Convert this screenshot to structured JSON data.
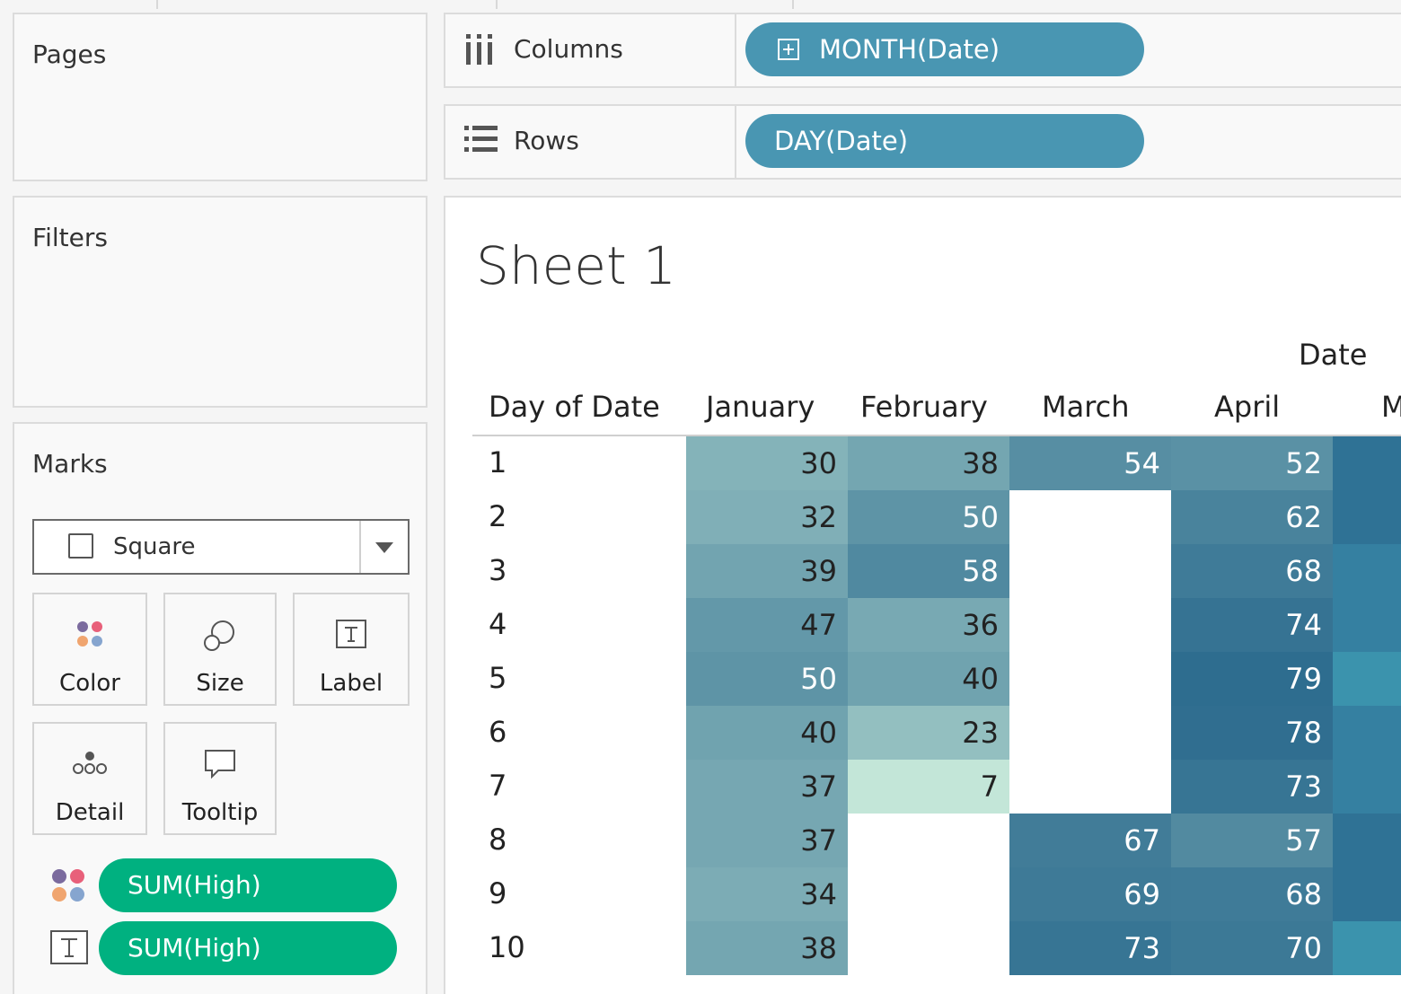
{
  "panels": {
    "pages": {
      "title": "Pages"
    },
    "filters": {
      "title": "Filters"
    },
    "marks": {
      "title": "Marks",
      "mark_type": "Square",
      "buttons": {
        "color": "Color",
        "size": "Size",
        "label": "Label",
        "detail": "Detail",
        "tooltip": "Tooltip"
      },
      "fields": [
        {
          "encoding": "color-icon",
          "label": "SUM(High)"
        },
        {
          "encoding": "label-icon",
          "label": "SUM(High)"
        }
      ]
    }
  },
  "shelves": {
    "columns": {
      "label": "Columns",
      "pill": "MONTH(Date)"
    },
    "rows": {
      "label": "Rows",
      "pill": "DAY(Date)"
    }
  },
  "viz": {
    "title": "Sheet 1",
    "column_group_label": "Date",
    "row_header": "Day of Date",
    "month_headers": [
      "January",
      "February",
      "March",
      "April",
      "M"
    ]
  },
  "colors": {
    "measure_pill": "#00b180",
    "dimension_pill": "#4996b2",
    "heat_low": "#c3e6d8",
    "heat_high": "#2e6d8f"
  },
  "chart_data": {
    "type": "heatmap",
    "title": "Sheet 1",
    "xlabel": "Date",
    "ylabel": "Day of Date",
    "categories": [
      "January",
      "February",
      "March",
      "April"
    ],
    "rows": [
      "1",
      "2",
      "3",
      "4",
      "5",
      "6",
      "7",
      "8",
      "9",
      "10"
    ],
    "series": [
      {
        "name": "January",
        "values": [
          30,
          32,
          39,
          47,
          50,
          40,
          37,
          37,
          34,
          38
        ]
      },
      {
        "name": "February",
        "values": [
          38,
          50,
          58,
          36,
          40,
          23,
          7,
          null,
          null,
          null
        ]
      },
      {
        "name": "March",
        "values": [
          54,
          null,
          null,
          null,
          null,
          null,
          null,
          67,
          69,
          73
        ]
      },
      {
        "name": "April",
        "values": [
          52,
          62,
          68,
          74,
          79,
          78,
          73,
          57,
          68,
          70
        ]
      }
    ]
  }
}
